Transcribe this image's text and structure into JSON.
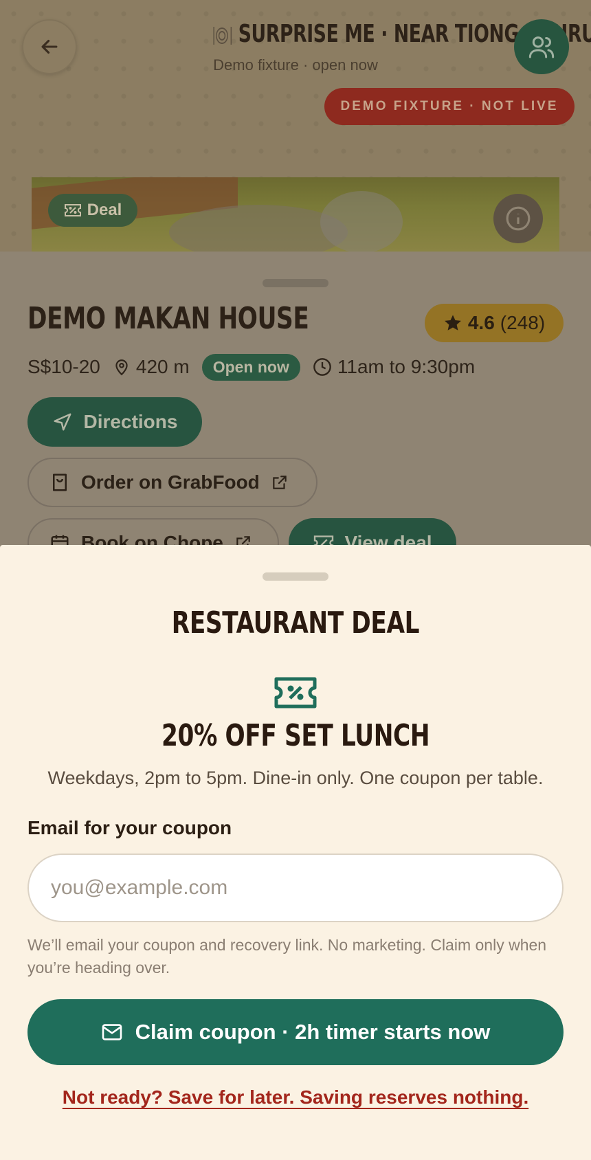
{
  "header": {
    "title": "SURPRISE ME · NEAR TIONG BAHRU",
    "subtitle": "Demo fixture · open now",
    "badge": "DEMO FIXTURE · NOT LIVE"
  },
  "hero": {
    "deal_chip": "Deal"
  },
  "place": {
    "name": "DEMO MAKAN HOUSE",
    "rating": "4.6",
    "reviews": "(248)",
    "price": "S$10-20",
    "distance": "420 m",
    "status": "Open now",
    "hours": "11am to 9:30pm"
  },
  "actions": {
    "directions": "Directions",
    "grabfood": "Order on GrabFood",
    "chope": "Book on Chope",
    "view_deal": "View deal"
  },
  "sheet": {
    "title": "RESTAURANT DEAL",
    "deal_title": "20% OFF SET LUNCH",
    "deal_desc": "Weekdays, 2pm to 5pm. Dine-in only. One coupon per table.",
    "email_label": "Email for your coupon",
    "email_placeholder": "you@example.com",
    "email_value": "",
    "helper": "We’ll email your coupon and recovery link. No marketing. Claim only when you’re heading over.",
    "claim_button": "Claim coupon · 2h timer starts now",
    "save_link": "Not ready? Save for later. Saving reserves nothing."
  },
  "colors": {
    "primary_green": "#1f6e5b",
    "cream": "#fbf2e3",
    "alert_red": "#a3261c",
    "rating_gold": "#e2ac36"
  },
  "icons": [
    "back-arrow-icon",
    "plate-icon",
    "people-icon",
    "ticket-percent-icon",
    "info-icon",
    "star-icon",
    "map-pin-icon",
    "clock-icon",
    "navigation-icon",
    "shopping-bag-icon",
    "external-link-icon",
    "calendar-icon",
    "mail-icon"
  ]
}
